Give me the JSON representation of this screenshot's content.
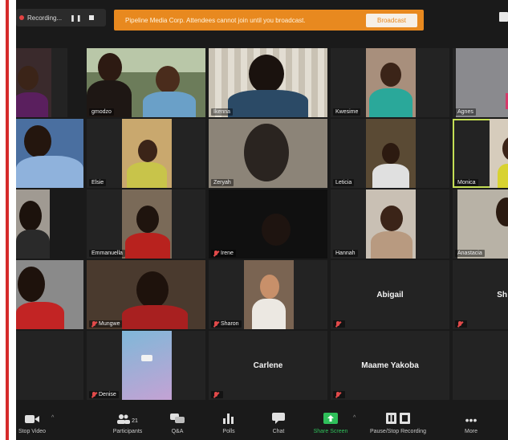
{
  "recording": {
    "status_label": "Recording...",
    "pause_glyph": "❚❚"
  },
  "banner": {
    "message": "Pipeline Media Corp. Attendees cannot join until you broadcast.",
    "button_label": "Broadcast"
  },
  "participants_grid": [
    {
      "name": "",
      "muted": false
    },
    {
      "name": "gmodzo",
      "muted": false
    },
    {
      "name": "Ikenna",
      "muted": false
    },
    {
      "name": "Kwesime",
      "muted": false
    },
    {
      "name": "Agnes",
      "muted": false
    },
    {
      "name": "",
      "muted": false
    },
    {
      "name": "Elsie",
      "muted": false
    },
    {
      "name": "Zeryah",
      "muted": false
    },
    {
      "name": "Leticia",
      "muted": false
    },
    {
      "name": "Monica",
      "muted": false
    },
    {
      "name": "",
      "muted": false
    },
    {
      "name": "Emmanuella",
      "muted": false
    },
    {
      "name": "Irene",
      "muted": true
    },
    {
      "name": "Hannah",
      "muted": false
    },
    {
      "name": "Anastacia",
      "muted": false
    },
    {
      "name": "",
      "muted": false
    },
    {
      "name": "Mungwe",
      "muted": true
    },
    {
      "name": "Sharon",
      "muted": true
    },
    {
      "name": "Abigail",
      "muted": true
    },
    {
      "name": "Sh",
      "muted": false
    },
    {
      "name": "",
      "muted": false
    },
    {
      "name": "Denise",
      "muted": true
    },
    {
      "name": "Carlene",
      "muted": true
    },
    {
      "name": "Maame Yakoba",
      "muted": true
    },
    {
      "name": "",
      "muted": false
    }
  ],
  "toolbar": {
    "stop_video": "Stop Video",
    "participants": "Participants",
    "participant_count": "21",
    "qa": "Q&A",
    "polls": "Polls",
    "chat": "Chat",
    "share_screen": "Share Screen",
    "pause_stop_recording": "Pause/Stop Recording",
    "more": "More"
  },
  "colors": {
    "background": "#1a1a1a",
    "banner": "#e8891f",
    "active_speaker": "#c4de55",
    "share_screen": "#2fbf5a",
    "muted": "#e24a4a"
  }
}
